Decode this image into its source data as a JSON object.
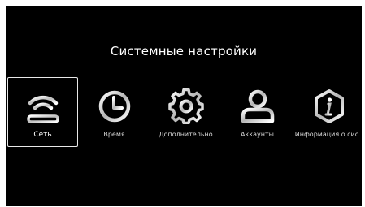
{
  "screen": {
    "title": "Системные настройки"
  },
  "tiles": [
    {
      "label": "Сеть",
      "icon": "wifi-router-icon",
      "selected": true
    },
    {
      "label": "Время",
      "icon": "clock-icon",
      "selected": false
    },
    {
      "label": "Дополнительно",
      "icon": "gear-icon",
      "selected": false
    },
    {
      "label": "Аккаунты",
      "icon": "user-icon",
      "selected": false
    },
    {
      "label": "Информация о сис..",
      "icon": "info-icon",
      "selected": false
    }
  ],
  "colors": {
    "background": "#000000",
    "text": "#ffffff",
    "selection_border": "#e8e8e8"
  }
}
